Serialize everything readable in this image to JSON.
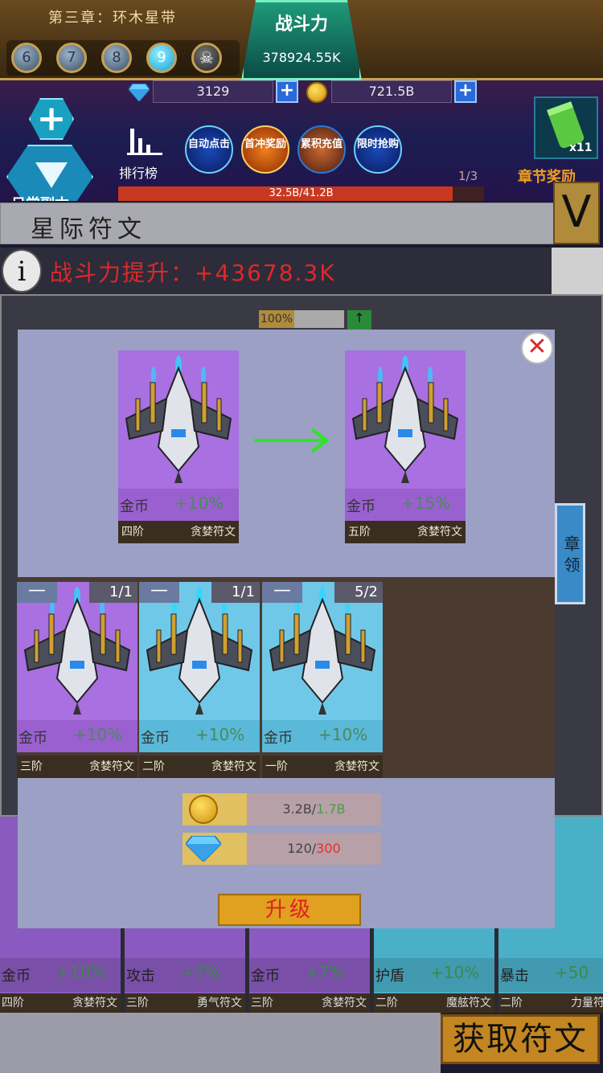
{
  "hud": {
    "chapter_title": "第三章：环木星带",
    "levels": [
      "6",
      "7",
      "8",
      "9"
    ],
    "active_level": "9",
    "power_label": "战斗力",
    "power_value": "378924.55K",
    "gems": "3129",
    "gold": "721.5B",
    "rank_label": "排行榜",
    "btn_auto": "自动点击",
    "btn_first": "首冲奖励",
    "btn_cumulative": "累积充值",
    "btn_limited": "限时抢购",
    "daily_label": "日常副本",
    "progress_text": "32.5B/41.2B",
    "progress_fraction": 0.914,
    "ratio": "1/3",
    "reward_count": "x11",
    "reward_label": "章节奖励"
  },
  "section": {
    "title": "星际符文",
    "v_button": "V",
    "info_icon": "i",
    "power_up": "战斗力提升：+43678.3K"
  },
  "background": {
    "percent": "100%",
    "up_arrow": "↑",
    "side_tile": "章 领",
    "cards": [
      {
        "stat": "金币",
        "value": "+10%",
        "tier": "四阶",
        "name": "贪婪符文",
        "color": "#8a5ac0"
      },
      {
        "stat": "攻击",
        "value": "+7%",
        "tier": "三阶",
        "name": "勇气符文",
        "color": "#8a5ac0"
      },
      {
        "stat": "金币",
        "value": "+7%",
        "tier": "三阶",
        "name": "贪婪符文",
        "color": "#8a5ac0"
      },
      {
        "stat": "护盾",
        "value": "+10%",
        "tier": "二阶",
        "name": "魔舷符文",
        "color": "#4ab0c8"
      },
      {
        "stat": "暴击",
        "value": "+50",
        "tier": "二阶",
        "name": "力量符文",
        "color": "#4ab0c8"
      }
    ],
    "get_button": "获取符文"
  },
  "modal": {
    "close": "✕",
    "from_card": {
      "stat": "金币",
      "value": "+10%",
      "tier": "四阶",
      "name": "贪婪符文"
    },
    "to_card": {
      "stat": "金币",
      "value": "+15%",
      "tier": "五阶",
      "name": "贪婪符文"
    },
    "materials": [
      {
        "minus": "—",
        "count": "1/1",
        "stat": "金币",
        "value": "+10%",
        "tier": "三阶",
        "name": "贪婪符文",
        "color": "#a870e0"
      },
      {
        "minus": "—",
        "count": "1/1",
        "stat": "金币",
        "value": "+10%",
        "tier": "二阶",
        "name": "贪婪符文",
        "color": "#70c8e8"
      },
      {
        "minus": "—",
        "count": "5/2",
        "stat": "金币",
        "value": "+10%",
        "tier": "一阶",
        "name": "贪婪符文",
        "color": "#70c8e8"
      }
    ],
    "cost_gold_have": "3.2B",
    "cost_gold_need": "1.7B",
    "cost_gem_have": "120",
    "cost_gem_need": "300",
    "upgrade_button": "升级"
  },
  "colors": {
    "purple_card": "#a870e0",
    "blue_card": "#70c8e8",
    "modal_bg": "#9ba0c4",
    "upgrade_btn": "#e0a020"
  }
}
